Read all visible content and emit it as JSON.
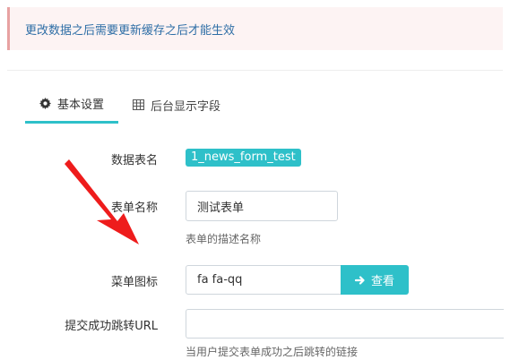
{
  "alert": {
    "text": "更改数据之后需要更新缓存之后才能生效"
  },
  "tabs": [
    {
      "label": "基本设置",
      "icon": "gear-icon",
      "active": true
    },
    {
      "label": "后台显示字段",
      "icon": "table-icon",
      "active": false
    }
  ],
  "form": {
    "table_name": {
      "label": "数据表名",
      "value": "1_news_form_test"
    },
    "form_name": {
      "label": "表单名称",
      "value": "测试表单",
      "help": "表单的描述名称"
    },
    "menu_icon": {
      "label": "菜单图标",
      "value": "fa fa-qq",
      "button_label": "查看",
      "button_icon": "arrow-right-icon"
    },
    "redirect_url": {
      "label": "提交成功跳转URL",
      "value": "",
      "help": "当用户提交表单成功之后跳转的链接"
    }
  },
  "colors": {
    "accent": "#2ec0c9",
    "alert_bg": "#fdf3f3",
    "alert_text": "#2e6ea6",
    "annotation_arrow": "#ee1c1c"
  }
}
